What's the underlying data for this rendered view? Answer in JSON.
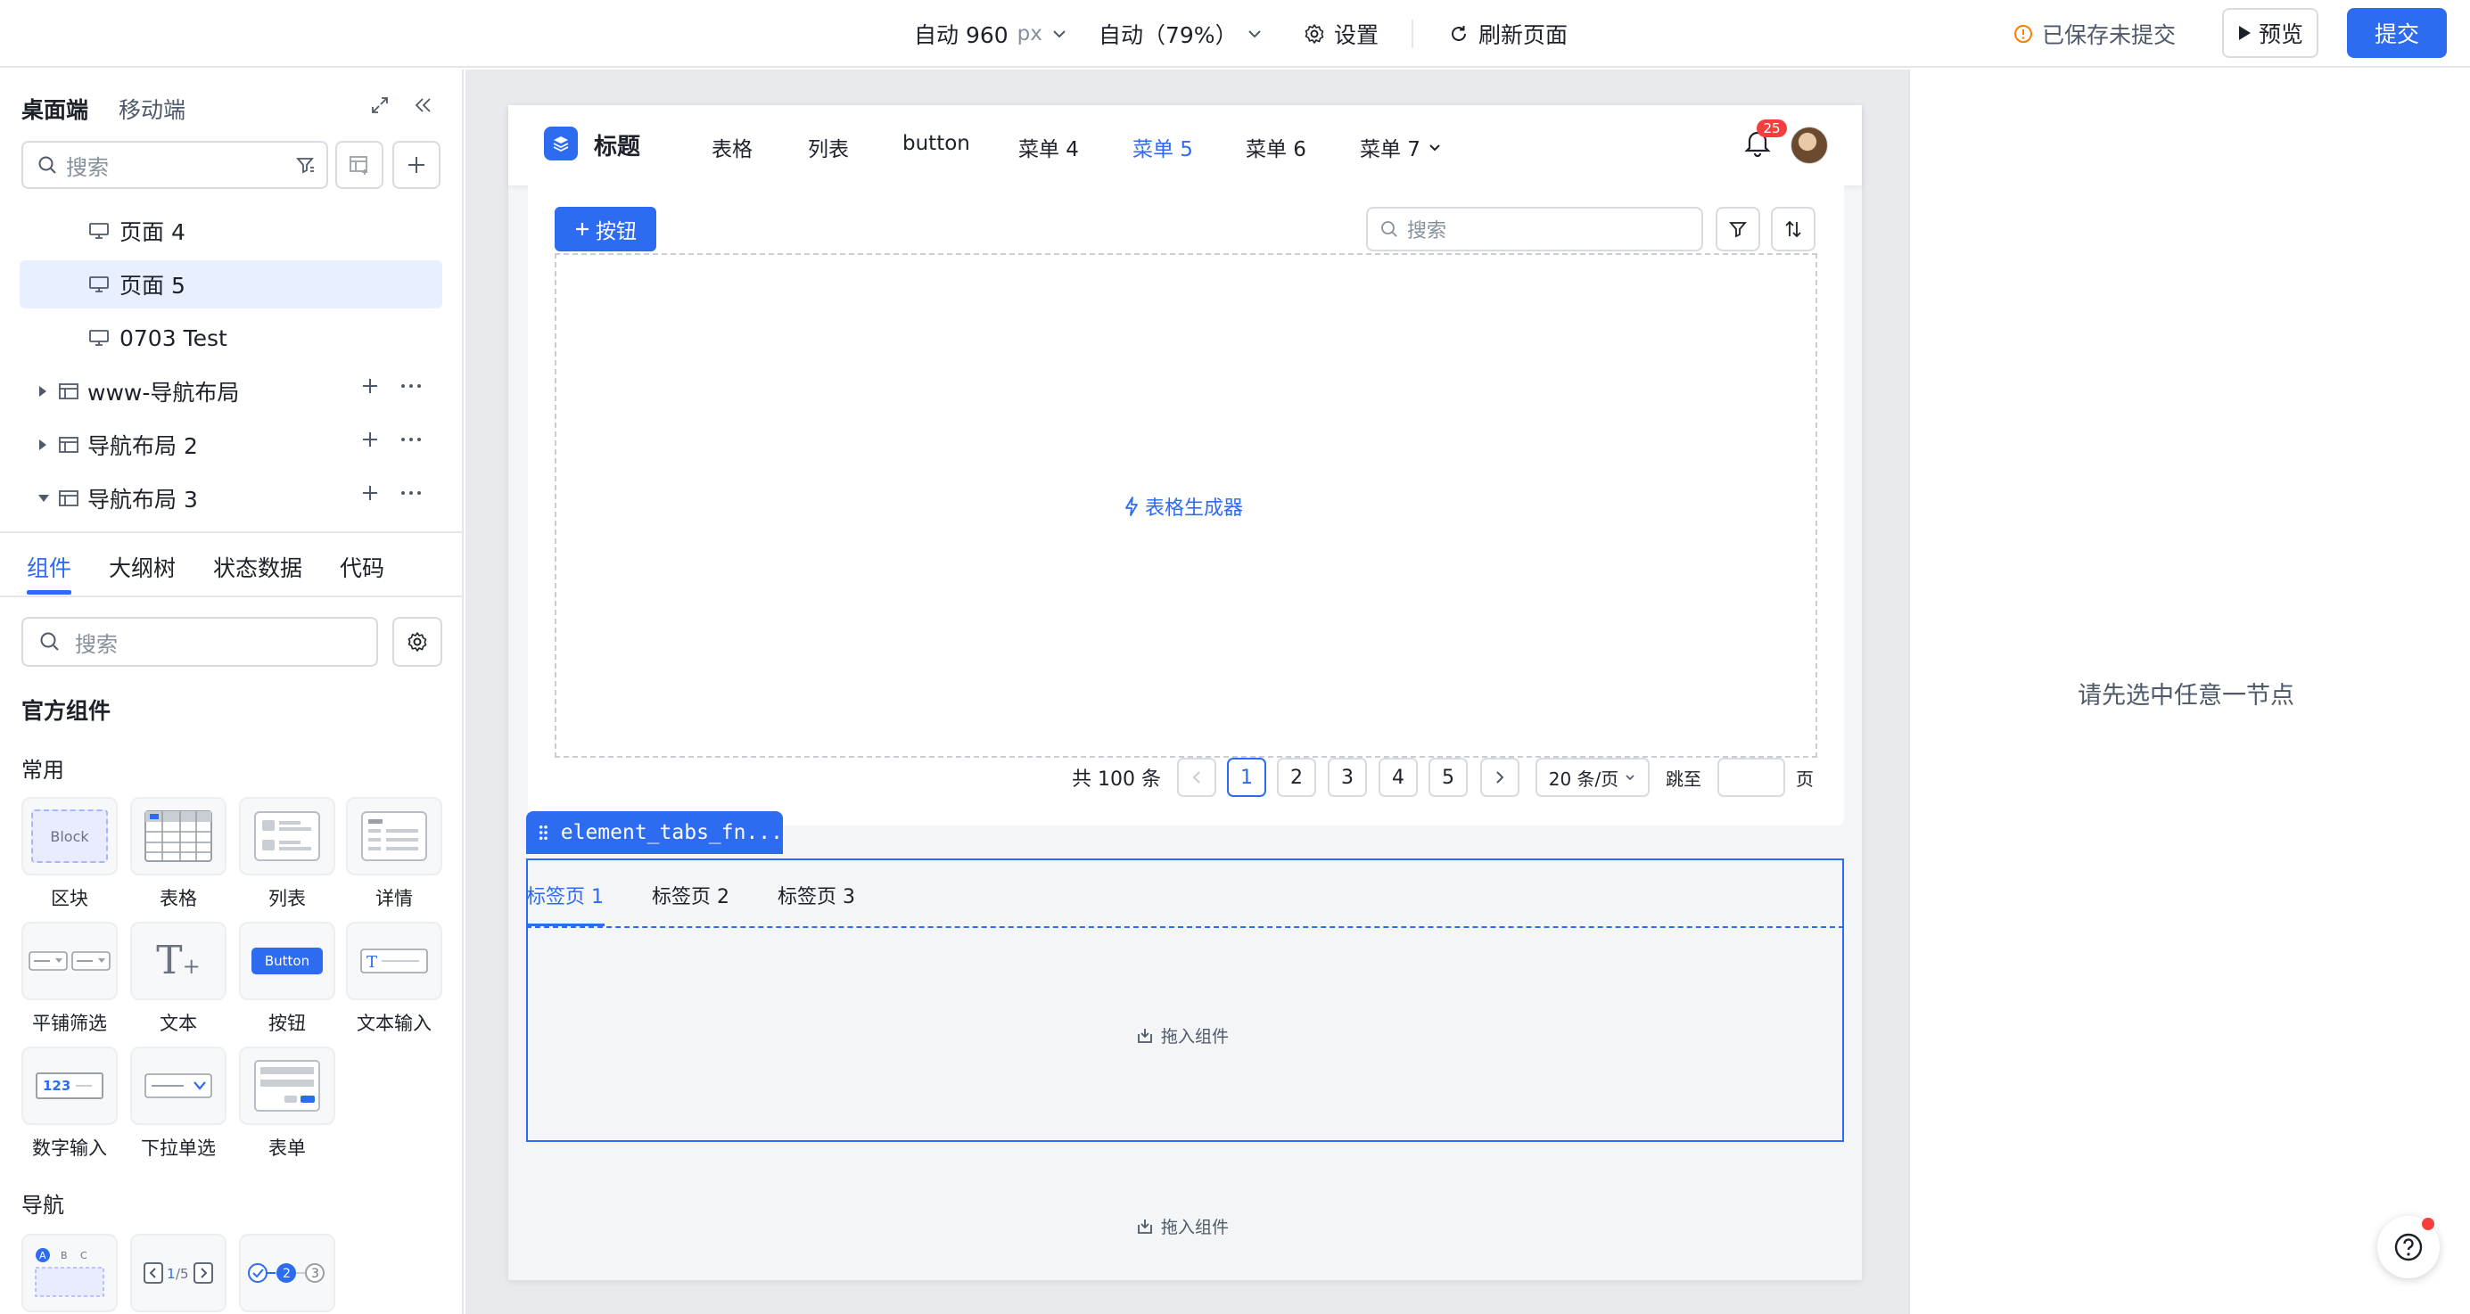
{
  "topbar": {
    "width_label": "自动 960",
    "width_unit": "px",
    "zoom_label": "自动（79%）",
    "settings_label": "设置",
    "refresh_label": "刷新页面",
    "status_label": "已保存未提交",
    "preview_label": "预览",
    "submit_label": "提交"
  },
  "left": {
    "tabs": [
      "桌面端",
      "移动端"
    ],
    "search_placeholder": "搜索",
    "tree": [
      {
        "label": "页面 4",
        "type": "page"
      },
      {
        "label": "页面 5",
        "type": "page",
        "selected": true
      },
      {
        "label": "0703 Test",
        "type": "page"
      },
      {
        "label": "www-导航布局",
        "type": "layout",
        "expanded": false
      },
      {
        "label": "导航布局 2",
        "type": "layout",
        "expanded": false
      },
      {
        "label": "导航布局 3",
        "type": "layout",
        "expanded": true
      }
    ],
    "sub_tabs": [
      "组件",
      "大纲树",
      "状态数据",
      "代码"
    ],
    "comp_search_placeholder": "搜索",
    "official_title": "官方组件",
    "groups": {
      "common": "常用",
      "nav": "导航"
    },
    "components": [
      {
        "label": "区块",
        "icon": "block-icon",
        "thumb": "Block"
      },
      {
        "label": "表格",
        "icon": "table-icon"
      },
      {
        "label": "列表",
        "icon": "list-icon"
      },
      {
        "label": "详情",
        "icon": "detail-icon"
      },
      {
        "label": "平铺筛选",
        "icon": "filter-tile-icon"
      },
      {
        "label": "文本",
        "icon": "text-icon"
      },
      {
        "label": "按钮",
        "icon": "button-icon",
        "thumb": "Button"
      },
      {
        "label": "文本输入",
        "icon": "text-input-icon"
      },
      {
        "label": "数字输入",
        "icon": "number-input-icon",
        "thumb": "123"
      },
      {
        "label": "下拉单选",
        "icon": "select-icon"
      },
      {
        "label": "表单",
        "icon": "form-icon"
      }
    ],
    "nav_components": [
      {
        "icon": "tabs-icon",
        "thumb": "A B C"
      },
      {
        "icon": "pagination-icon",
        "thumb": "1 / 5"
      },
      {
        "icon": "steps-icon",
        "thumb": "2 3"
      }
    ]
  },
  "canvas": {
    "nav_title": "标题",
    "menus": [
      "表格",
      "列表",
      "button",
      "菜单 4",
      "菜单 5",
      "菜单 6",
      "菜单 7"
    ],
    "active_menu": "菜单 5",
    "notification_count": "25",
    "add_button": "按钮",
    "search_placeholder": "搜索",
    "table_generator": "表格生成器",
    "pagination": {
      "total": "共 100 条",
      "pages": [
        "1",
        "2",
        "3",
        "4",
        "5"
      ],
      "current": "1",
      "page_size": "20 条/页",
      "jump_label": "跳至",
      "page_unit": "页"
    },
    "selected_component": "element_tabs_fn...",
    "tabs": [
      "标签页 1",
      "标签页 2",
      "标签页 3"
    ],
    "drop_hint": "拖入组件"
  },
  "right": {
    "hint": "请先选中任意一节点"
  },
  "colors": {
    "primary": "#2d6bf0",
    "danger": "#f53f3f",
    "warning": "#ff7d00"
  }
}
